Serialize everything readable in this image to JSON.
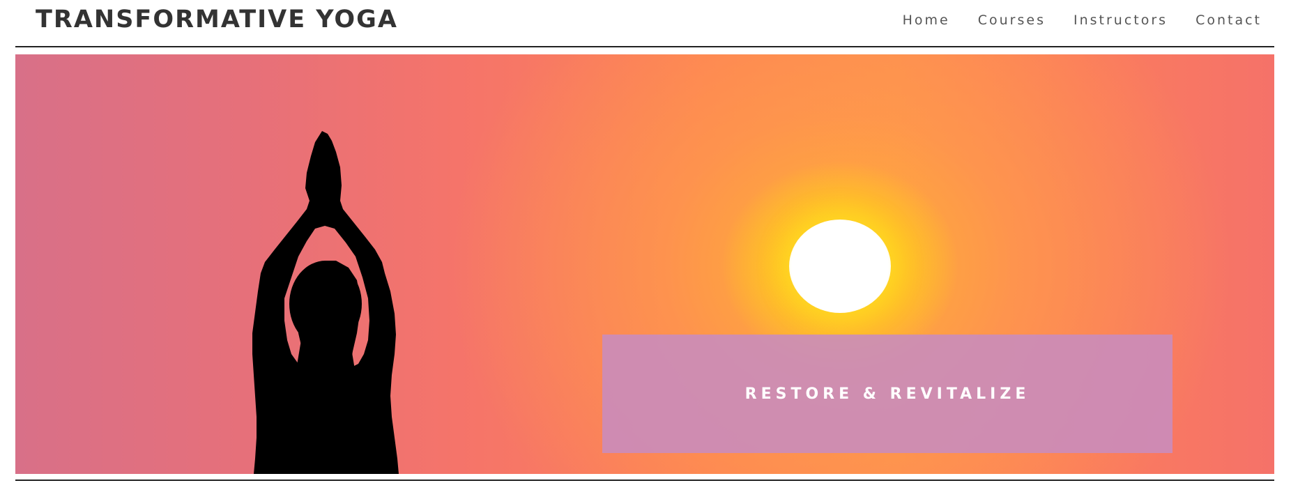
{
  "header": {
    "brand": "TRANSFORMATIVE YOGA",
    "nav": [
      {
        "label": "Home"
      },
      {
        "label": "Courses"
      },
      {
        "label": "Instructors"
      },
      {
        "label": "Contact"
      }
    ]
  },
  "hero": {
    "banner_text": "RESTORE & REVITALIZE",
    "image_subject": "yoga-silhouette-at-sunset"
  },
  "colors": {
    "brand_text": "#333333",
    "nav_text": "#555555",
    "banner_bg": "#c88cbe",
    "sunset_orange": "#fe8a55",
    "sun_yellow": "#ffd714"
  }
}
